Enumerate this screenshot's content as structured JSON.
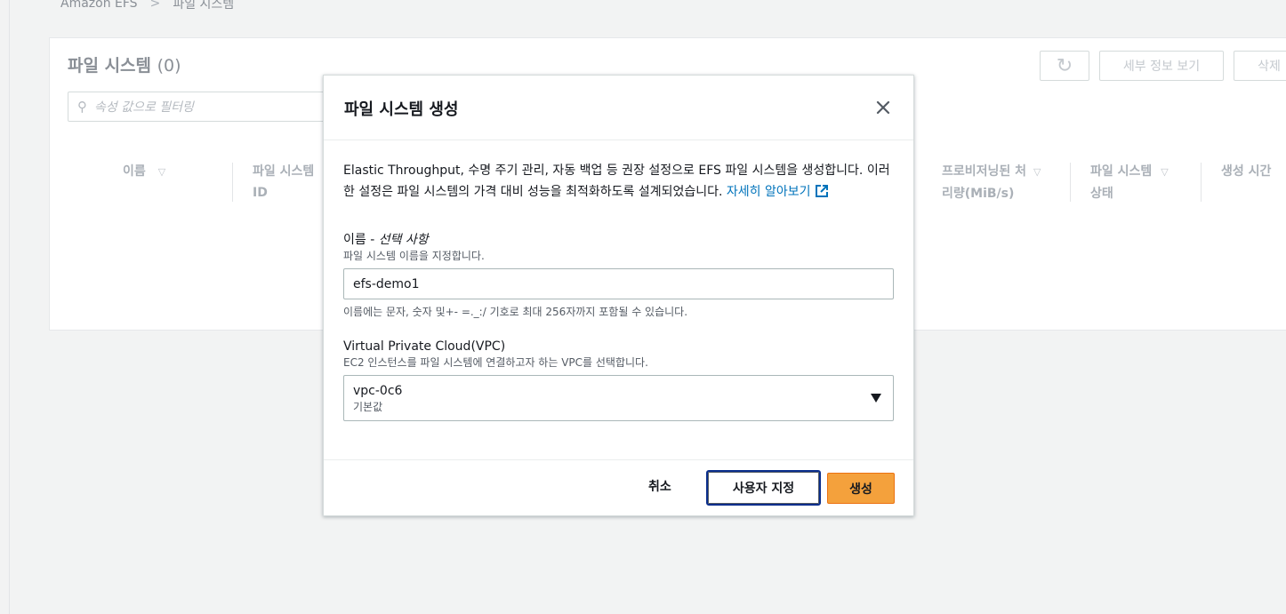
{
  "breadcrumb": {
    "root": "Amazon EFS",
    "current": "파일 시스템"
  },
  "panel": {
    "title": "파일 시스템",
    "count": "(0)",
    "filter_placeholder": "속성 값으로 필터링",
    "buttons": {
      "details": "세부 정보 보기",
      "delete": "삭제"
    },
    "columns": [
      {
        "label": "이름",
        "sub": ""
      },
      {
        "label": "파일 시스템",
        "sub": "ID"
      },
      {
        "label": "프로비저닝된 처",
        "sub": "리량(MiB/s)"
      },
      {
        "label": "파일 시스템",
        "sub": "상태"
      },
      {
        "label": "생성 시간",
        "sub": ""
      }
    ]
  },
  "modal": {
    "title": "파일 시스템 생성",
    "description": "Elastic Throughput, 수명 주기 관리, 자동 백업 등 권장 설정으로 EFS 파일 시스템을 생성합니다. 이러한 설정은 파일 시스템의 가격 대비 성능을 최적화하도록 설계되었습니다.",
    "learn_more": "자세히 알아보기",
    "name_field": {
      "label": "이름 - ",
      "optional": "선택 사항",
      "description": "파일 시스템 이름을 지정합니다.",
      "value": "efs-demo1",
      "constraint": "이름에는 문자, 숫자 및+- =._:/ 기호로 최대 256자까지 포함될 수 있습니다."
    },
    "vpc_field": {
      "label": "Virtual Private Cloud(VPC)",
      "description": "EC2 인스턴스를 파일 시스템에 연결하고자 하는 VPC를 선택합니다.",
      "selected": "vpc-0c6",
      "selected_sub": "기본값"
    },
    "footer": {
      "cancel": "취소",
      "customize": "사용자 지정",
      "create": "생성"
    }
  }
}
